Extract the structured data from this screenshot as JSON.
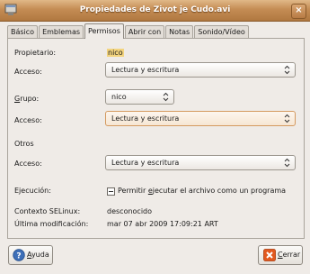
{
  "window": {
    "title": "Propiedades de Zivot je Cudo.avi",
    "title_color": "#c48c54"
  },
  "tabs": [
    {
      "label": "Básico"
    },
    {
      "label": "Emblemas"
    },
    {
      "label": "Permisos",
      "active": true
    },
    {
      "label": "Abrir con"
    },
    {
      "label": "Notas"
    },
    {
      "label": "Sonido/Vídeo"
    }
  ],
  "permissions": {
    "owner_label": "Propietario:",
    "owner_value": "nico",
    "owner_access_label": "Acceso:",
    "owner_access_value": "Lectura y escritura",
    "group_label_first": "G",
    "group_label_rest": "rupo:",
    "group_value": "nico",
    "group_access_label": "Acceso:",
    "group_access_value": "Lectura y escritura",
    "others_label": "Otros",
    "others_access_label": "Acceso:",
    "others_access_value": "Lectura y escritura",
    "execution_label": "Ejecución:",
    "execution_checkbox_pre": "Permitir ",
    "execution_checkbox_u": "e",
    "execution_checkbox_post": "jecutar el archivo como un programa",
    "selinux_label": "Contexto SELinux:",
    "selinux_value": "desconocido",
    "modified_label": "Última modificación:",
    "modified_value": "mar 07 abr 2009 17:09:21 ART"
  },
  "buttons": {
    "help_u": "A",
    "help_rest": "yuda",
    "close_u": "C",
    "close_rest": "errar"
  },
  "icons": {
    "app": "window-icon",
    "close_titlebar": "close-icon",
    "help": "help-icon",
    "close": "close-icon",
    "combo_arrow": "updown-arrow-icon"
  }
}
